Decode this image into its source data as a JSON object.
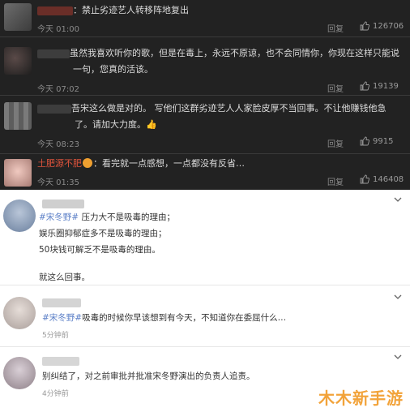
{
  "dark_comments": [
    {
      "name": "",
      "text": "：禁止劣迹艺人转移阵地复出",
      "time": "今天 01:00",
      "reply": "回复",
      "likes": "126706"
    },
    {
      "name": "",
      "text": "虽然我喜欢听你的歌，但是在毒上，永远不原谅，也不会同情你，你现在这样只能说一句，您真的活该。",
      "time": "今天 07:02",
      "reply": "回复",
      "likes": "19139"
    },
    {
      "name": "",
      "text": "吾宋这么做是对的。 写他们这群劣迹艺人人家脸皮厚不当回事。不让他赚钱他急了。请加大力度。👍",
      "time": "今天 08:23",
      "reply": "回复",
      "likes": "9915"
    },
    {
      "name": "土肥源不肥",
      "text": "：看完就一点感想，一点都没有反省…",
      "time": "今天 01:35",
      "reply": "回复",
      "likes": "146408"
    }
  ],
  "light_comments": [
    {
      "name": "",
      "tag": "#宋冬野#",
      "lines": [
        "压力大不是吸毒的理由；",
        "娱乐圈抑郁症多不是吸毒的理由；",
        "50块钱可解乏不是吸毒的理由。",
        "",
        "就这么回事。"
      ],
      "time": ""
    },
    {
      "name": "",
      "tag": "#宋冬野#",
      "lines": [
        "吸毒的时候你早该想到有今天，不知道你在委屈什么…"
      ],
      "time": "5分钟前"
    },
    {
      "name": "",
      "tag": "",
      "lines": [
        "别纠结了，对之前审批并批准宋冬野演出的负责人追责。"
      ],
      "time": "4分钟前"
    }
  ],
  "watermark": "木木新手游",
  "colors": {
    "dark_bg": "#222222",
    "name_red": "#e0543c",
    "tag_blue": "#5b7fc7",
    "watermark": "#f2a33a"
  }
}
